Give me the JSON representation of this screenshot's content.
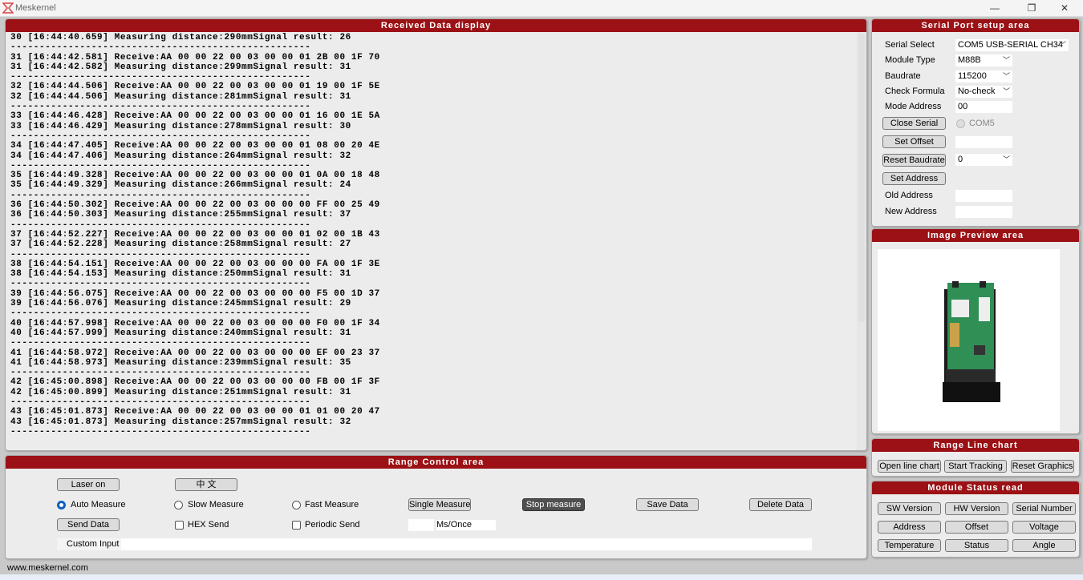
{
  "app": {
    "title": "Meskernel",
    "footer": "www.meskernel.com",
    "accent": "#9b1115"
  },
  "window_controls": {
    "minimize": "—",
    "maximize": "❐",
    "close": "✕"
  },
  "received": {
    "title": "Received Data display",
    "lines": [
      "30 [16:44:40.659] Measuring distance:290mmSignal result: 26",
      "----------------------------------------------------",
      "31 [16:44:42.581] Receive:AA 00 00 22 00 03 00 00 01 2B 00 1F 70",
      "31 [16:44:42.582] Measuring distance:299mmSignal result: 31",
      "----------------------------------------------------",
      "32 [16:44:44.506] Receive:AA 00 00 22 00 03 00 00 01 19 00 1F 5E",
      "32 [16:44:44.506] Measuring distance:281mmSignal result: 31",
      "----------------------------------------------------",
      "33 [16:44:46.428] Receive:AA 00 00 22 00 03 00 00 01 16 00 1E 5A",
      "33 [16:44:46.429] Measuring distance:278mmSignal result: 30",
      "----------------------------------------------------",
      "34 [16:44:47.405] Receive:AA 00 00 22 00 03 00 00 01 08 00 20 4E",
      "34 [16:44:47.406] Measuring distance:264mmSignal result: 32",
      "----------------------------------------------------",
      "35 [16:44:49.328] Receive:AA 00 00 22 00 03 00 00 01 0A 00 18 48",
      "35 [16:44:49.329] Measuring distance:266mmSignal result: 24",
      "----------------------------------------------------",
      "36 [16:44:50.302] Receive:AA 00 00 22 00 03 00 00 00 FF 00 25 49",
      "36 [16:44:50.303] Measuring distance:255mmSignal result: 37",
      "----------------------------------------------------",
      "37 [16:44:52.227] Receive:AA 00 00 22 00 03 00 00 01 02 00 1B 43",
      "37 [16:44:52.228] Measuring distance:258mmSignal result: 27",
      "----------------------------------------------------",
      "38 [16:44:54.151] Receive:AA 00 00 22 00 03 00 00 00 FA 00 1F 3E",
      "38 [16:44:54.153] Measuring distance:250mmSignal result: 31",
      "----------------------------------------------------",
      "39 [16:44:56.075] Receive:AA 00 00 22 00 03 00 00 00 F5 00 1D 37",
      "39 [16:44:56.076] Measuring distance:245mmSignal result: 29",
      "----------------------------------------------------",
      "40 [16:44:57.998] Receive:AA 00 00 22 00 03 00 00 00 F0 00 1F 34",
      "40 [16:44:57.999] Measuring distance:240mmSignal result: 31",
      "----------------------------------------------------",
      "41 [16:44:58.972] Receive:AA 00 00 22 00 03 00 00 00 EF 00 23 37",
      "41 [16:44:58.973] Measuring distance:239mmSignal result: 35",
      "----------------------------------------------------",
      "42 [16:45:00.898] Receive:AA 00 00 22 00 03 00 00 00 FB 00 1F 3F",
      "42 [16:45:00.899] Measuring distance:251mmSignal result: 31",
      "----------------------------------------------------",
      "43 [16:45:01.873] Receive:AA 00 00 22 00 03 00 00 01 01 00 20 47",
      "43 [16:45:01.873] Measuring distance:257mmSignal result: 32",
      "----------------------------------------------------"
    ]
  },
  "serial": {
    "title": "Serial Port setup area",
    "serial_select_label": "Serial Select",
    "serial_select_value": "COM5 USB-SERIAL CH34",
    "module_type_label": "Module Type",
    "module_type_value": "M88B",
    "baudrate_label": "Baudrate",
    "baudrate_value": "115200",
    "check_formula_label": "Check Formula",
    "check_formula_value": "No-check",
    "mode_address_label": "Mode Address",
    "mode_address_value": "00",
    "close_serial": "Close Serial",
    "com_radio_label": "COM5",
    "set_offset": "Set Offset",
    "offset_value": "",
    "reset_baudrate": "Reset Baudrate",
    "reset_baudrate_value": "0",
    "set_address": "Set Address",
    "old_address_label": "Old Address",
    "old_address_value": "",
    "new_address_label": "New Address",
    "new_address_value": ""
  },
  "preview": {
    "title": "Image Preview area"
  },
  "linechart": {
    "title": "Range Line chart",
    "open": "Open line chart",
    "track": "Start Tracking",
    "reset": "Reset Graphics"
  },
  "status": {
    "title": "Module Status read",
    "buttons": [
      "SW Version",
      "HW Version",
      "Serial Number",
      "Address",
      "Offset",
      "Voltage",
      "Temperature",
      "Status",
      "Angle"
    ]
  },
  "control": {
    "title": "Range Control area",
    "laser": "Laser    on",
    "lang": "中    文",
    "auto": "Auto Measure",
    "slow": "Slow Measure",
    "fast": "Fast Measure",
    "selected_mode": "Auto Measure",
    "single": "Single Measure",
    "stop": "Stop measure",
    "save": "Save Data",
    "delete": "Delete Data",
    "send": "Send Data",
    "hex": "HEX Send",
    "hex_checked": false,
    "periodic": "Periodic Send",
    "periodic_checked": false,
    "period_value": "",
    "period_unit": "Ms/Once",
    "custom_label": "Custom Input",
    "custom_value": ""
  }
}
